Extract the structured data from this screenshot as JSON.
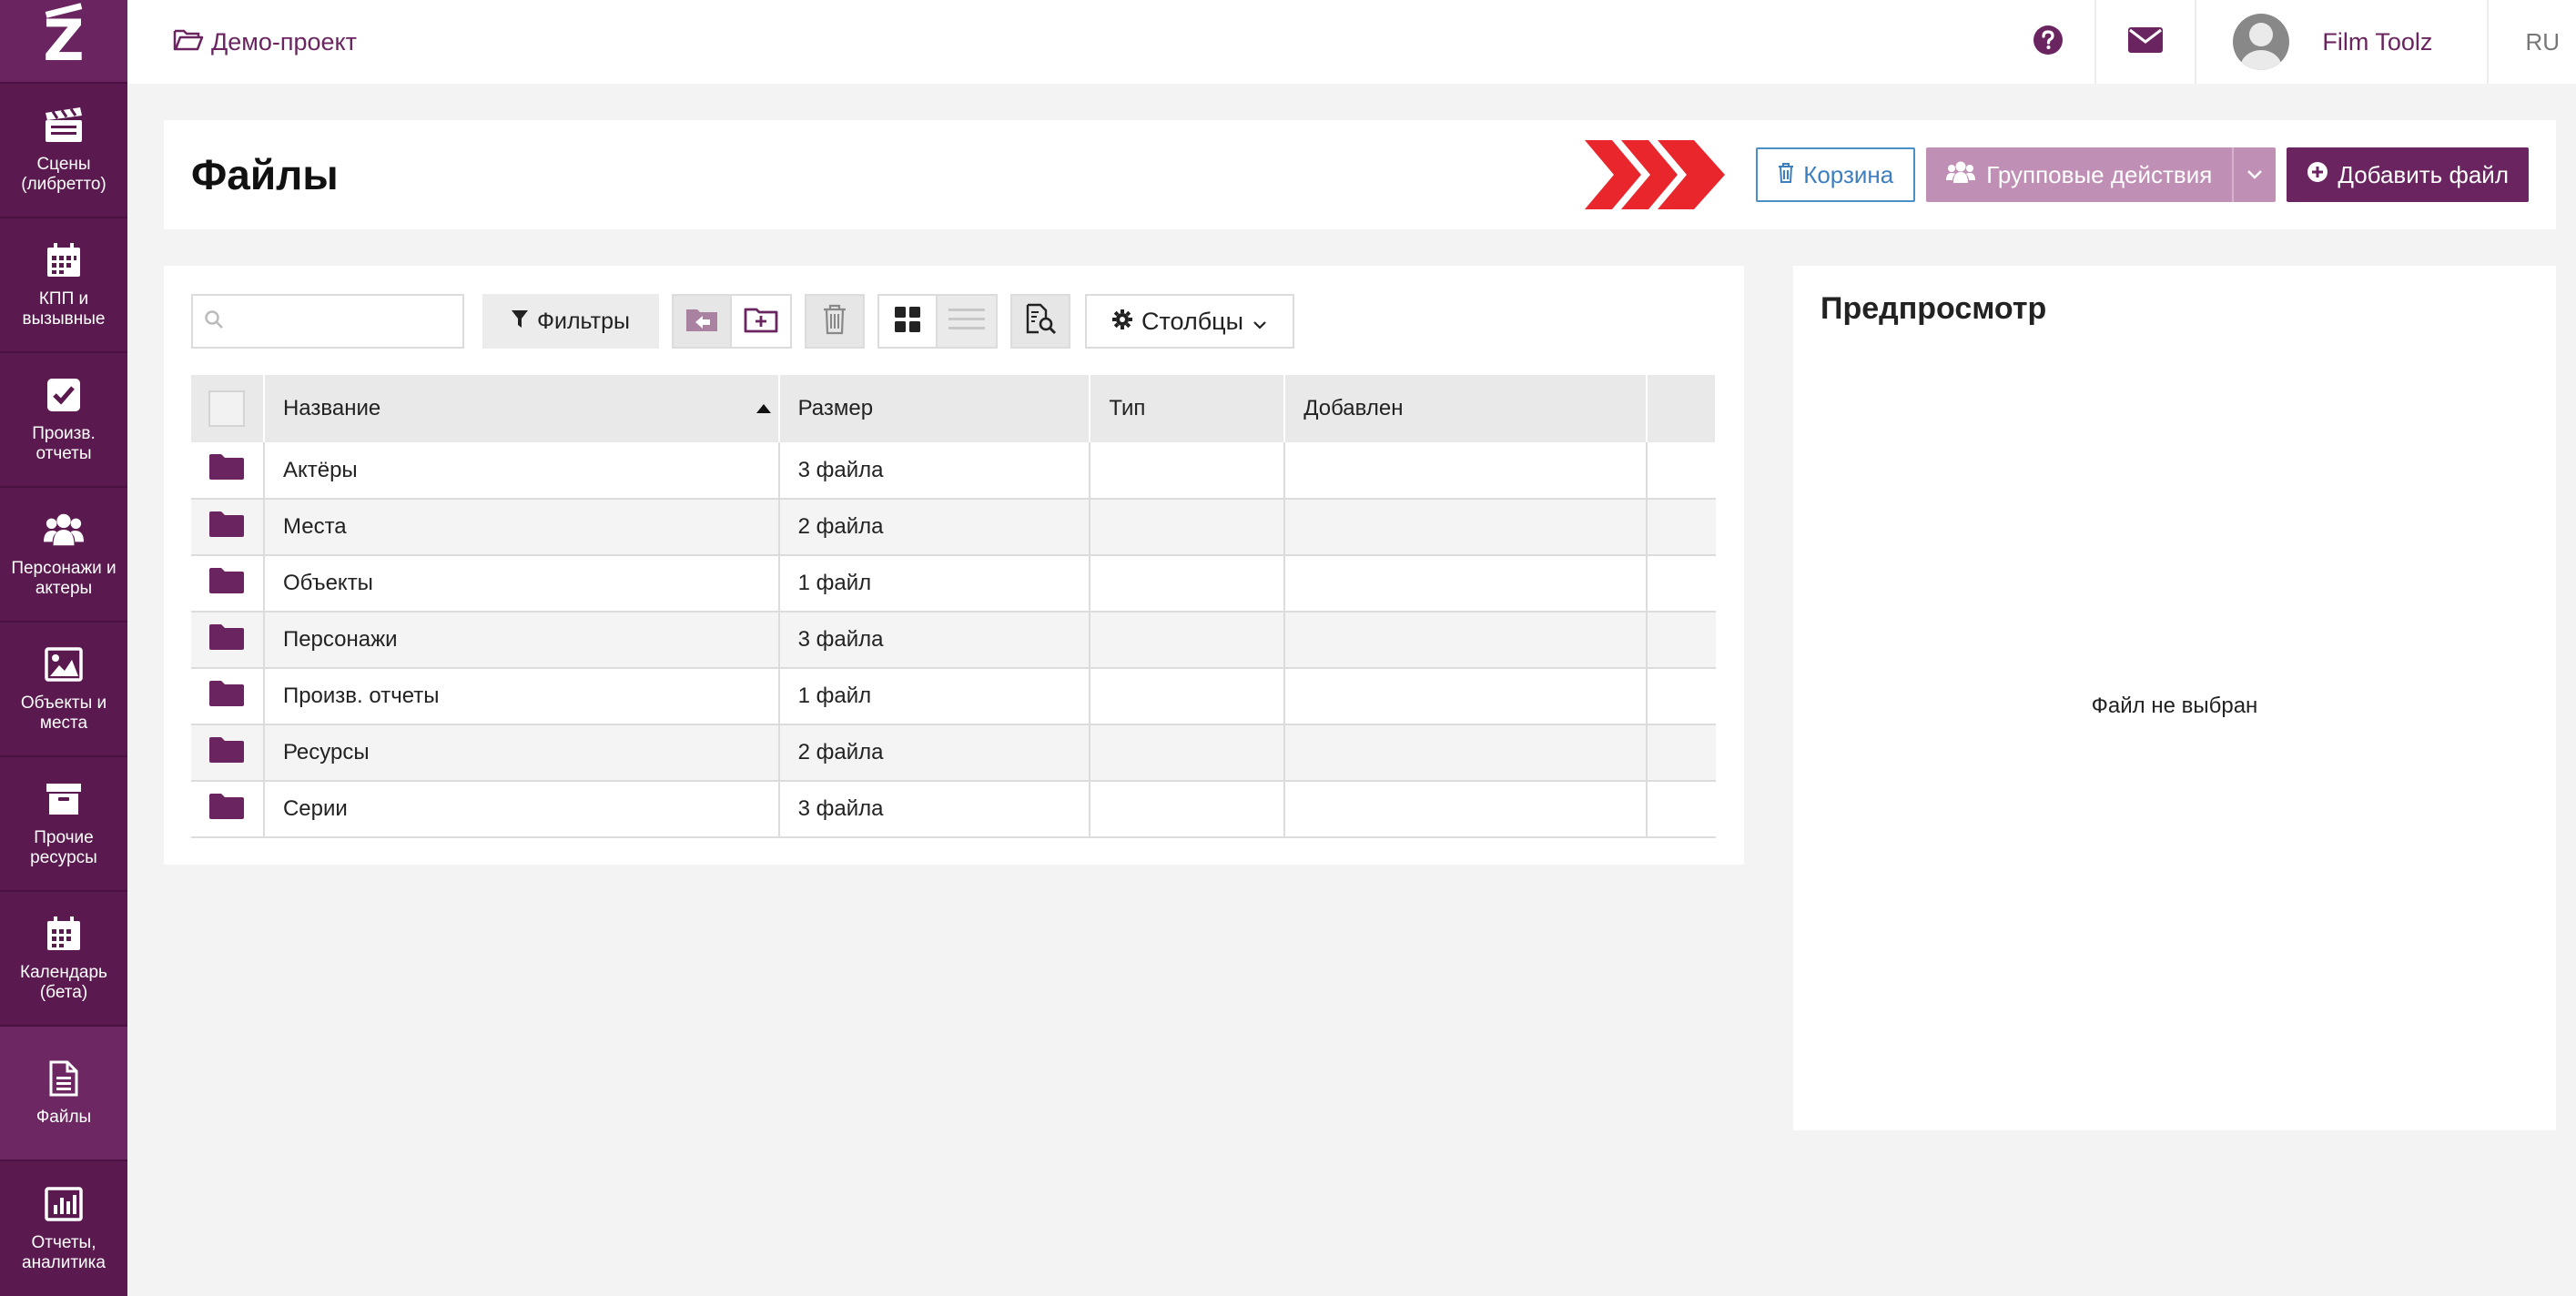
{
  "colors": {
    "brand": "#6a2560",
    "sidebar": "#5b1a4f",
    "folder": "#6a2560",
    "trash_button": "#3c7fc0",
    "group_actions_disabled": "#c08fb6",
    "arrow_accent": "#e8262b"
  },
  "sidebar": {
    "logo": "Z",
    "items": [
      {
        "label": "Сцены (либретто)",
        "icon": "clapperboard-icon"
      },
      {
        "label": "КПП и вызывные",
        "icon": "calendar-grid-icon"
      },
      {
        "label": "Произв. отчеты",
        "icon": "checkbox-icon"
      },
      {
        "label": "Персонажи и актеры",
        "icon": "users-icon"
      },
      {
        "label": "Объекты и места",
        "icon": "image-icon"
      },
      {
        "label": "Прочие ресурсы",
        "icon": "archive-icon"
      },
      {
        "label": "Календарь (бета)",
        "icon": "calendar-icon"
      },
      {
        "label": "Файлы",
        "icon": "file-icon"
      },
      {
        "label": "Отчеты, аналитика",
        "icon": "bar-chart-icon"
      }
    ],
    "active_index": 7
  },
  "topbar": {
    "project_name": "Демо-проект",
    "user_name": "Film Toolz",
    "language": "RU"
  },
  "header": {
    "title": "Файлы",
    "trash_label": "Корзина",
    "group_actions_label": "Групповые действия",
    "add_file_label": "Добавить файл"
  },
  "toolbar": {
    "search_placeholder": "",
    "filters_label": "Фильтры",
    "columns_label": "Столбцы"
  },
  "table": {
    "columns": [
      "Название",
      "Размер",
      "Тип",
      "Добавлен"
    ],
    "rows": [
      {
        "name": "Актёры",
        "size": "3 файла",
        "type": "",
        "added": ""
      },
      {
        "name": "Места",
        "size": "2 файла",
        "type": "",
        "added": ""
      },
      {
        "name": "Объекты",
        "size": "1 файл",
        "type": "",
        "added": ""
      },
      {
        "name": "Персонажи",
        "size": "3 файла",
        "type": "",
        "added": ""
      },
      {
        "name": "Произв. отчеты",
        "size": "1 файл",
        "type": "",
        "added": ""
      },
      {
        "name": "Ресурсы",
        "size": "2 файла",
        "type": "",
        "added": ""
      },
      {
        "name": "Серии",
        "size": "3 файла",
        "type": "",
        "added": ""
      }
    ]
  },
  "preview": {
    "title": "Предпросмотр",
    "empty_text": "Файл не выбран"
  }
}
